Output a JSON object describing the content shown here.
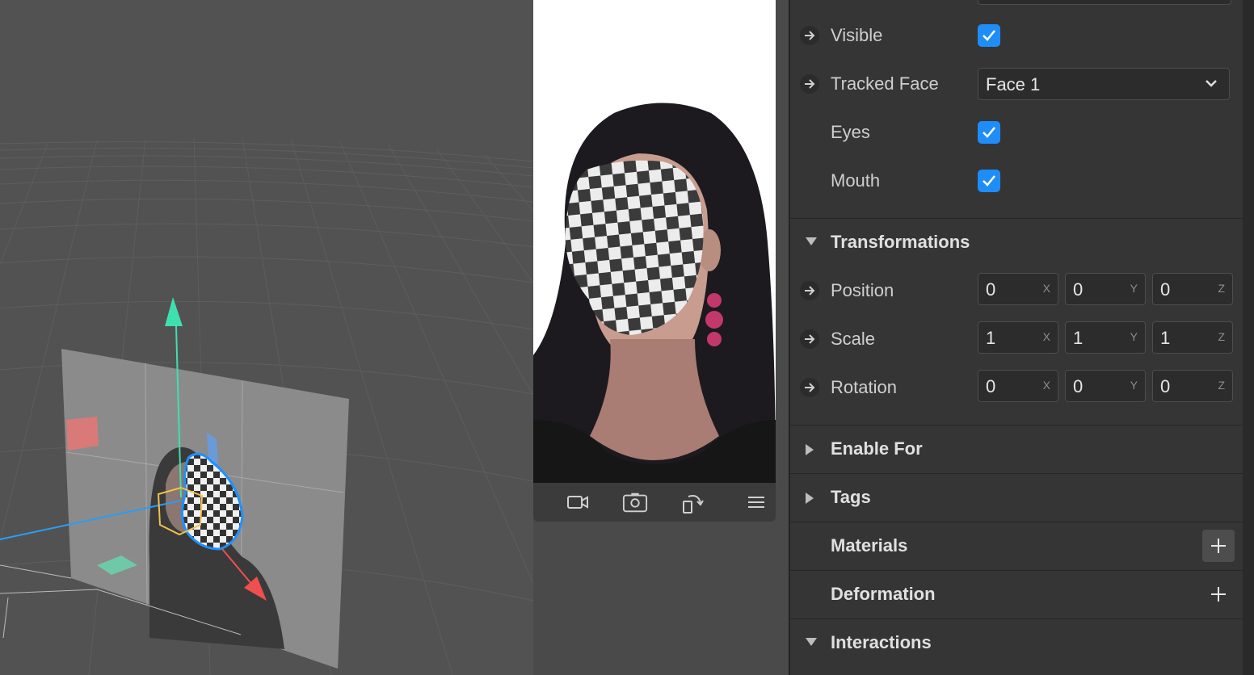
{
  "inspector": {
    "visible_label": "Visible",
    "tracked_face_label": "Tracked Face",
    "tracked_face_value": "Face 1",
    "eyes_label": "Eyes",
    "mouth_label": "Mouth",
    "transformations_title": "Transformations",
    "position_label": "Position",
    "scale_label": "Scale",
    "rotation_label": "Rotation",
    "position": {
      "x": "0",
      "y": "0",
      "z": "0"
    },
    "scale": {
      "x": "1",
      "y": "1",
      "z": "1"
    },
    "rotation": {
      "x": "0",
      "y": "0",
      "z": "0"
    },
    "axis_x": "X",
    "axis_y": "Y",
    "axis_z": "Z",
    "enable_for_title": "Enable For",
    "tags_title": "Tags",
    "materials_title": "Materials",
    "deformation_title": "Deformation",
    "interactions_title": "Interactions"
  },
  "simulator": {
    "toolbar_icons": [
      "video-camera-icon",
      "switch-camera-icon",
      "rotate-device-icon",
      "menu-icon"
    ]
  },
  "colors": {
    "checkbox_blue": "#1f8df7",
    "gizmo_green": "#3fe0b0",
    "gizmo_blue": "#2a9df4",
    "gizmo_red": "#f04f4f",
    "selection_blue": "#1e90ff"
  }
}
